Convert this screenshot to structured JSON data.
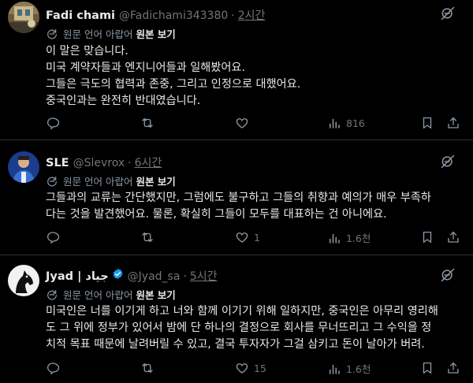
{
  "tweets": [
    {
      "name": "Fadi chami",
      "handle": "@Fadichami343380",
      "time": "2시간",
      "translate_source": "원문 언어 아랍어",
      "translate_view": "원본 보기",
      "lines": [
        "이 말은 맞습니다.",
        "미국 계약자들과 엔지니어들과 일해봤어요.",
        "그들은 극도의 협력과 존중, 그리고 인정으로 대했어요.",
        "중국인과는 완전히 반대였습니다."
      ],
      "replies": "",
      "reposts": "",
      "likes": "",
      "views": "816"
    },
    {
      "name": "SLE",
      "handle": "@Slevrox",
      "time": "6시간",
      "translate_source": "원문 언어 아랍어",
      "translate_view": "원본 보기",
      "lines": [
        "그들과의 교류는 간단했지만, 그럼에도 불구하고 그들의 취향과 예의가 매우 부족하",
        "다는 것을 발견했어요. 물론, 확실히 그들이 모두를 대표하는 건 아니에요."
      ],
      "replies": "",
      "reposts": "",
      "likes": "1",
      "views": "1.6천"
    },
    {
      "name": "جياد | Jyad",
      "handle": "@Jyad_sa",
      "time": "5시간",
      "translate_source": "원문 언어 아랍어",
      "translate_view": "원본 보기",
      "lines": [
        "미국인은 너를 이기게 하고 너와 함께 이기기 위해 일하지만, 중국인은 아무리 영리해",
        "도 그 위에 정부가 있어서 밤에 단 하나의 결정으로 회사를 무너뜨리고 그 수익을 정",
        "치적 목표 때문에 날려버릴 수 있고, 결국 투자자가 그걸 삼키고 돈이 날아가 버려."
      ],
      "replies": "",
      "reposts": "",
      "likes": "15",
      "views": "1.6천"
    }
  ],
  "separator": "·",
  "colors": {
    "background": "#000000",
    "text": "#e7e9ea",
    "muted": "#71767b",
    "divider": "#2f3336",
    "verified": "#1d9bf0"
  },
  "icons": [
    "translate-icon",
    "globe-icon",
    "reply-icon",
    "repost-icon",
    "like-icon",
    "views-icon",
    "bookmark-icon",
    "share-icon",
    "verified-badge-icon"
  ]
}
